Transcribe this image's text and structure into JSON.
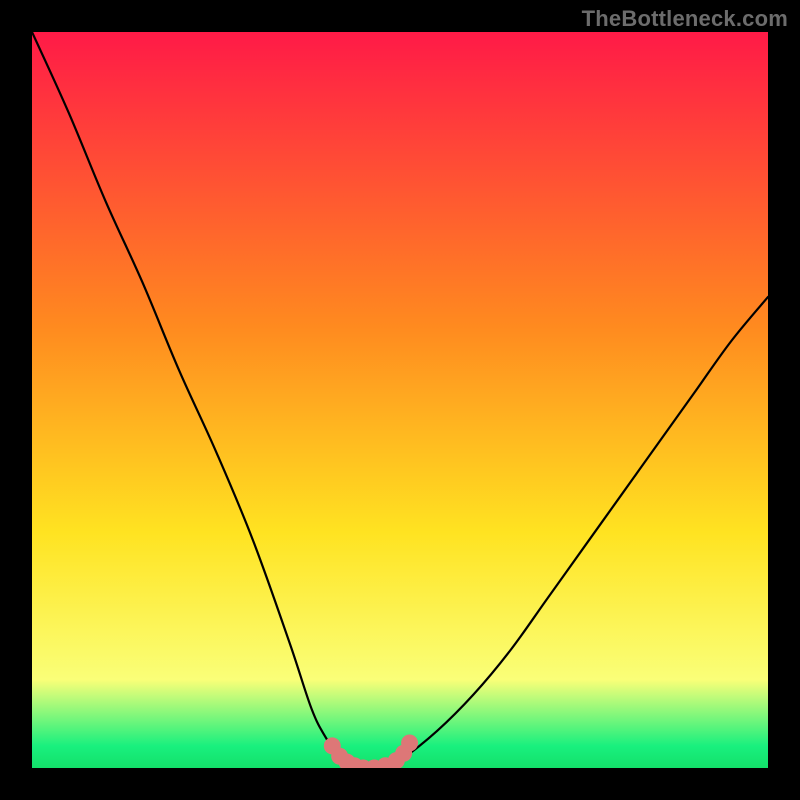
{
  "watermark": "TheBottleneck.com",
  "colors": {
    "background": "#000000",
    "curve": "#000000",
    "marker": "#dd7777",
    "gradient_top": "#ff1a47",
    "gradient_mid1": "#ff8a1f",
    "gradient_mid2": "#ffe321",
    "gradient_mid3": "#faff78",
    "gradient_green": "#19f07e",
    "gradient_bottom": "#13e06a"
  },
  "chart_data": {
    "type": "line",
    "title": "",
    "xlabel": "",
    "ylabel": "",
    "xlim": [
      0,
      100
    ],
    "ylim": [
      0,
      100
    ],
    "grid": false,
    "legend": false,
    "series": [
      {
        "name": "bottleneck-curve",
        "x": [
          0,
          5,
          10,
          15,
          20,
          25,
          30,
          35,
          38,
          40,
          42,
          44,
          46,
          48,
          50,
          55,
          60,
          65,
          70,
          75,
          80,
          85,
          90,
          95,
          100
        ],
        "y": [
          100,
          89,
          77,
          66,
          54,
          43,
          31,
          17,
          8,
          4,
          1,
          0,
          0,
          0,
          1,
          5,
          10,
          16,
          23,
          30,
          37,
          44,
          51,
          58,
          64
        ]
      }
    ],
    "annotations": [
      {
        "name": "bottom-markers",
        "type": "points",
        "x": [
          40.8,
          41.8,
          42.8,
          43.8,
          45.0,
          46.5,
          48.0,
          49.5,
          50.5,
          51.3
        ],
        "y": [
          3.0,
          1.6,
          0.8,
          0.3,
          0.0,
          0.0,
          0.3,
          1.0,
          2.0,
          3.4
        ]
      }
    ]
  }
}
